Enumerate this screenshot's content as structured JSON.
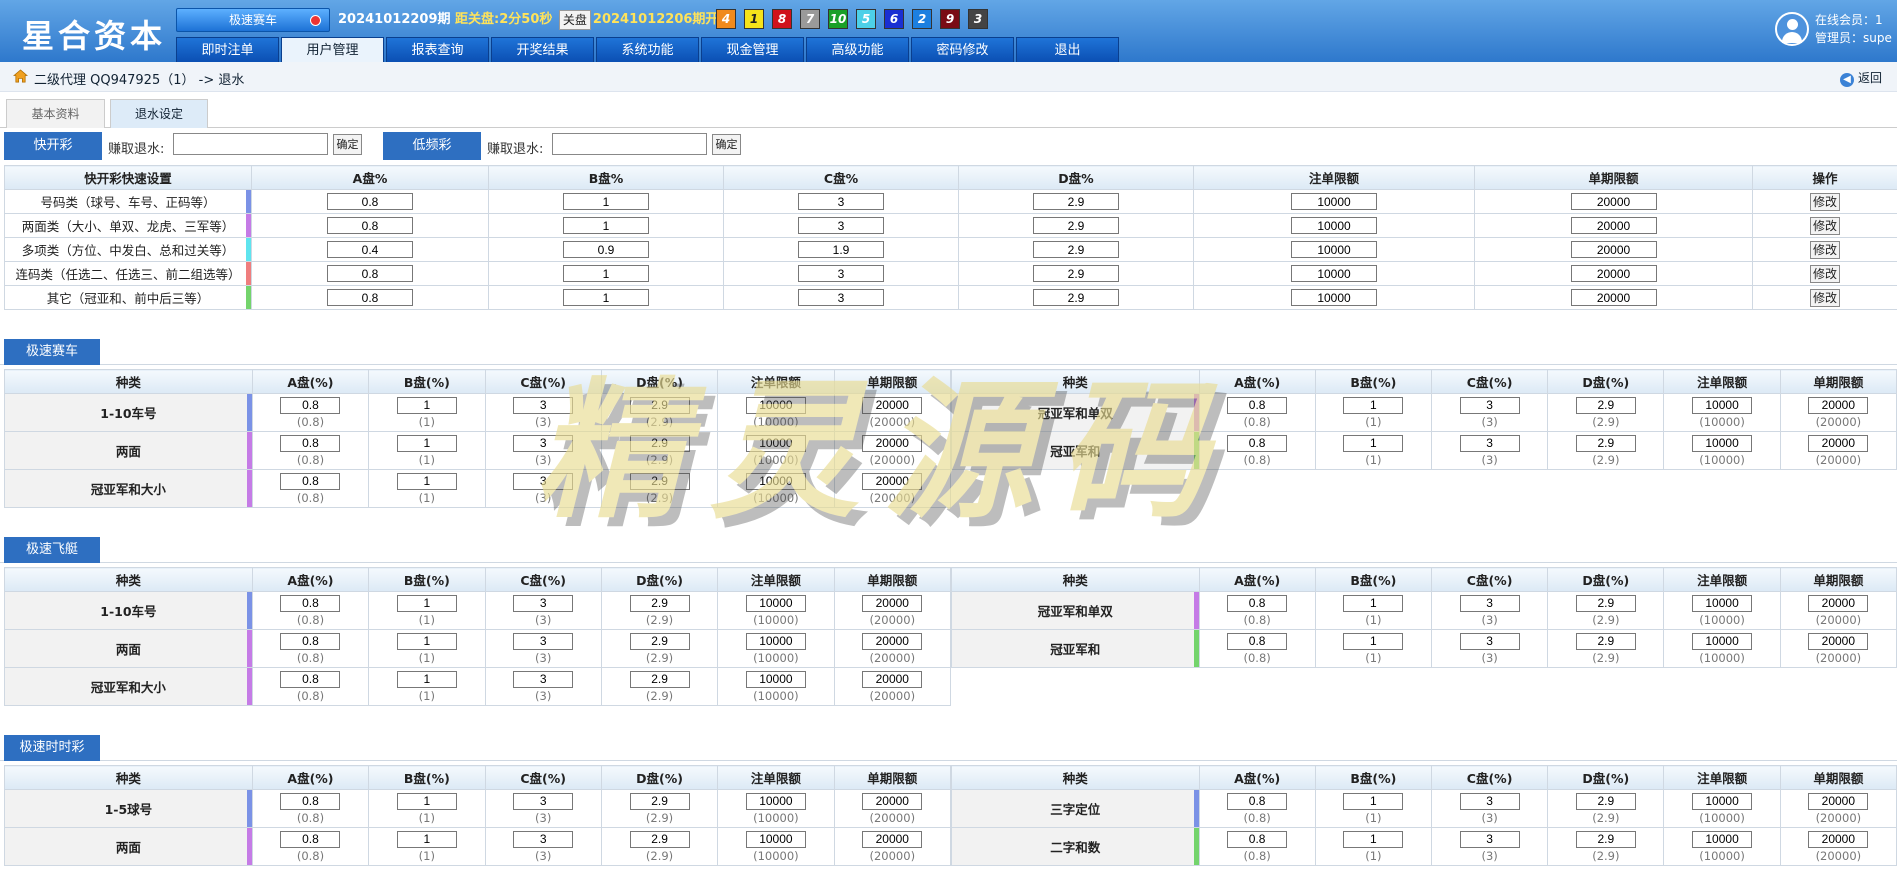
{
  "header": {
    "brand": "星合资本",
    "game_select": "极速赛车",
    "cur_issue": "20241012209期",
    "close_label": "距关盘:",
    "close_time": "2分50秒",
    "close_btn": "关盘",
    "last_issue": "20241012206期开奖:",
    "balls": [
      {
        "n": "4",
        "c": "#f08a1c"
      },
      {
        "n": "1",
        "c": "#f5e31a"
      },
      {
        "n": "8",
        "c": "#d0121b"
      },
      {
        "n": "7",
        "c": "#9a9a9a"
      },
      {
        "n": "10",
        "c": "#1aa028"
      },
      {
        "n": "5",
        "c": "#4dd0e8"
      },
      {
        "n": "6",
        "c": "#1a2fd2"
      },
      {
        "n": "2",
        "c": "#1c7fe0"
      },
      {
        "n": "9",
        "c": "#7a0c14"
      },
      {
        "n": "3",
        "c": "#444444"
      }
    ],
    "nav": [
      "即时注单",
      "用户管理",
      "报表查询",
      "开奖结果",
      "系统功能",
      "现金管理",
      "高级功能",
      "密码修改",
      "退出"
    ],
    "nav_active": 1,
    "online": "在线会员：1",
    "admin": "管理员：supe"
  },
  "breadcrumb": {
    "text": "二级代理 QQ947925（1） -> 退水",
    "back": "返回"
  },
  "tabs": [
    "基本资料",
    "退水设定"
  ],
  "quick": {
    "fast_btn": "快开彩",
    "slow_btn": "低频彩",
    "label": "赚取退水:",
    "ok": "确定",
    "headers": [
      "快开彩快速设置",
      "A盘%",
      "B盘%",
      "C盘%",
      "D盘%",
      "注单限额",
      "单期限额",
      "操作"
    ],
    "modify": "修改",
    "rows": [
      {
        "name": "号码类（球号、车号、正码等）",
        "vals": [
          "0.8",
          "1",
          "3",
          "2.9",
          "10000",
          "20000"
        ],
        "color": "#7b92e6"
      },
      {
        "name": "两面类（大小、单双、龙虎、三军等）",
        "vals": [
          "0.8",
          "1",
          "3",
          "2.9",
          "10000",
          "20000"
        ],
        "color": "#c57be6"
      },
      {
        "name": "多项类（方位、中发白、总和过关等）",
        "vals": [
          "0.4",
          "0.9",
          "1.9",
          "2.9",
          "10000",
          "20000"
        ],
        "color": "#5fe4ee"
      },
      {
        "name": "连码类（任选二、任选三、前二组选等）",
        "vals": [
          "0.8",
          "1",
          "3",
          "2.9",
          "10000",
          "20000"
        ],
        "color": "#ef7e7e"
      },
      {
        "name": "其它（冠亚和、前中后三等）",
        "vals": [
          "0.8",
          "1",
          "3",
          "2.9",
          "10000",
          "20000"
        ],
        "color": "#74d46c"
      }
    ]
  },
  "game_headers": [
    "种类",
    "A盘(%)",
    "B盘(%)",
    "C盘(%)",
    "D盘(%)",
    "注单限额",
    "单期限额"
  ],
  "sections": [
    {
      "title": "极速赛车",
      "left": [
        {
          "name": "1-10车号",
          "vals": [
            "0.8",
            "1",
            "3",
            "2.9",
            "10000",
            "20000"
          ],
          "defs": [
            "(0.8)",
            "(1)",
            "(3)",
            "(2.9)",
            "(10000)",
            "(20000)"
          ],
          "color": "#7b92e6"
        },
        {
          "name": "两面",
          "vals": [
            "0.8",
            "1",
            "3",
            "2.9",
            "10000",
            "20000"
          ],
          "defs": [
            "(0.8)",
            "(1)",
            "(3)",
            "(2.9)",
            "(10000)",
            "(20000)"
          ],
          "color": "#c57be6"
        },
        {
          "name": "冠亚军和大小",
          "vals": [
            "0.8",
            "1",
            "3",
            "2.9",
            "10000",
            "20000"
          ],
          "defs": [
            "(0.8)",
            "(1)",
            "(3)",
            "(2.9)",
            "(10000)",
            "(20000)"
          ],
          "color": "#c57be6"
        }
      ],
      "right": [
        {
          "name": "冠亚军和单双",
          "vals": [
            "0.8",
            "1",
            "3",
            "2.9",
            "10000",
            "20000"
          ],
          "defs": [
            "(0.8)",
            "(1)",
            "(3)",
            "(2.9)",
            "(10000)",
            "(20000)"
          ],
          "color": "#c57be6"
        },
        {
          "name": "冠亚军和",
          "vals": [
            "0.8",
            "1",
            "3",
            "2.9",
            "10000",
            "20000"
          ],
          "defs": [
            "(0.8)",
            "(1)",
            "(3)",
            "(2.9)",
            "(10000)",
            "(20000)"
          ],
          "color": "#74d46c"
        }
      ]
    },
    {
      "title": "极速飞艇",
      "left": [
        {
          "name": "1-10车号",
          "vals": [
            "0.8",
            "1",
            "3",
            "2.9",
            "10000",
            "20000"
          ],
          "defs": [
            "(0.8)",
            "(1)",
            "(3)",
            "(2.9)",
            "(10000)",
            "(20000)"
          ],
          "color": "#7b92e6"
        },
        {
          "name": "两面",
          "vals": [
            "0.8",
            "1",
            "3",
            "2.9",
            "10000",
            "20000"
          ],
          "defs": [
            "(0.8)",
            "(1)",
            "(3)",
            "(2.9)",
            "(10000)",
            "(20000)"
          ],
          "color": "#c57be6"
        },
        {
          "name": "冠亚军和大小",
          "vals": [
            "0.8",
            "1",
            "3",
            "2.9",
            "10000",
            "20000"
          ],
          "defs": [
            "(0.8)",
            "(1)",
            "(3)",
            "(2.9)",
            "(10000)",
            "(20000)"
          ],
          "color": "#c57be6"
        }
      ],
      "right": [
        {
          "name": "冠亚军和单双",
          "vals": [
            "0.8",
            "1",
            "3",
            "2.9",
            "10000",
            "20000"
          ],
          "defs": [
            "(0.8)",
            "(1)",
            "(3)",
            "(2.9)",
            "(10000)",
            "(20000)"
          ],
          "color": "#c57be6"
        },
        {
          "name": "冠亚军和",
          "vals": [
            "0.8",
            "1",
            "3",
            "2.9",
            "10000",
            "20000"
          ],
          "defs": [
            "(0.8)",
            "(1)",
            "(3)",
            "(2.9)",
            "(10000)",
            "(20000)"
          ],
          "color": "#74d46c"
        }
      ]
    },
    {
      "title": "极速时时彩",
      "left": [
        {
          "name": "1-5球号",
          "vals": [
            "0.8",
            "1",
            "3",
            "2.9",
            "10000",
            "20000"
          ],
          "defs": [
            "(0.8)",
            "(1)",
            "(3)",
            "(2.9)",
            "(10000)",
            "(20000)"
          ],
          "color": "#7b92e6"
        },
        {
          "name": "两面",
          "vals": [
            "0.8",
            "1",
            "3",
            "2.9",
            "10000",
            "20000"
          ],
          "defs": [
            "(0.8)",
            "(1)",
            "(3)",
            "(2.9)",
            "(10000)",
            "(20000)"
          ],
          "color": "#c57be6"
        }
      ],
      "right": [
        {
          "name": "三字定位",
          "vals": [
            "0.8",
            "1",
            "3",
            "2.9",
            "10000",
            "20000"
          ],
          "defs": [
            "(0.8)",
            "(1)",
            "(3)",
            "(2.9)",
            "(10000)",
            "(20000)"
          ],
          "color": "#7b92e6"
        },
        {
          "name": "二字和数",
          "vals": [
            "0.8",
            "1",
            "3",
            "2.9",
            "10000",
            "20000"
          ],
          "defs": [
            "(0.8)",
            "(1)",
            "(3)",
            "(2.9)",
            "(10000)",
            "(20000)"
          ],
          "color": "#74d46c"
        }
      ]
    }
  ],
  "watermark": "精灵源码"
}
